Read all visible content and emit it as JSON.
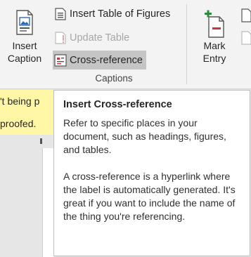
{
  "ribbon": {
    "insert_caption_label_line1": "Insert",
    "insert_caption_label_line2": "Caption",
    "insert_table_of_figures": "Insert Table of Figures",
    "update_table": "Update Table",
    "cross_reference": "Cross-reference",
    "group_label": "Captions",
    "mark_entry_line1": "Mark",
    "mark_entry_line2": "Entry"
  },
  "document": {
    "highlight_line1": "'t being p",
    "highlight_line2": "proofed."
  },
  "tooltip": {
    "title": "Insert Cross-reference",
    "paragraph1": "Refer to specific places in your document, such as headings, figures, and tables.",
    "paragraph2": "A cross-reference is a hyperlink where the label is automatically generated. It's great if you want to include the name of the thing you're referencing."
  },
  "colors": {
    "ribbon_bg": "#f3f3f3",
    "selected_button_bg": "#c5c5c5",
    "highlight_yellow": "#fff6a6",
    "disabled_text": "#a7a7a7",
    "icon_red": "#d13438",
    "icon_green": "#2e8b3e",
    "icon_blue": "#2b6cb0"
  },
  "icons": {
    "insert_caption": "insert-caption-icon",
    "table_of_figures": "table-of-figures-icon",
    "update_table": "update-table-icon",
    "cross_reference": "cross-reference-icon",
    "mark_entry": "mark-entry-icon"
  }
}
